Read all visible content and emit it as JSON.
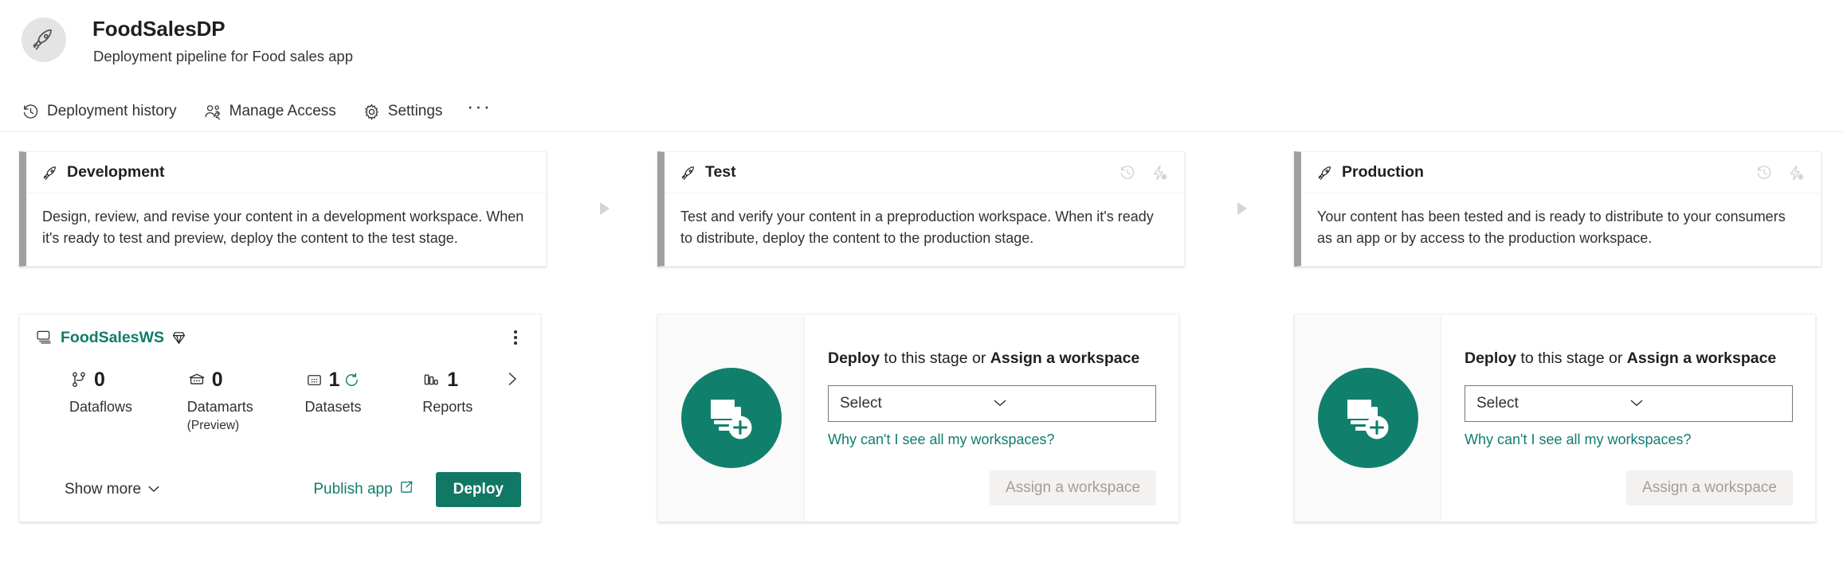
{
  "header": {
    "avatar_icon": "rocket-icon",
    "title": "FoodSalesDP",
    "subtitle": "Deployment pipeline for Food sales app"
  },
  "toolbar": {
    "items": [
      {
        "icon": "history-icon",
        "label": "Deployment history"
      },
      {
        "icon": "people-icon",
        "label": "Manage Access"
      },
      {
        "icon": "gear-icon",
        "label": "Settings"
      }
    ],
    "overflow_label": "···"
  },
  "colors": {
    "brand_green": "#117865",
    "link_teal": "#127c6d",
    "stage_accent": "#a19f9d",
    "disabled_text": "#a19f9d",
    "circle_green": "#10806c"
  },
  "stages": [
    {
      "name": "Development",
      "icon": "rocket-icon",
      "description": "Design, review, and revise your content in a development workspace. When it's ready to test and preview, deploy the content to the test stage.",
      "actions": []
    },
    {
      "name": "Test",
      "icon": "rocket-icon",
      "description": "Test and verify your content in a preproduction workspace. When it's ready to distribute, deploy the content to the production stage.",
      "actions": [
        {
          "icon": "history-icon"
        },
        {
          "icon": "deployment-rules-icon"
        }
      ]
    },
    {
      "name": "Production",
      "icon": "rocket-icon",
      "description": "Your content has been tested and is ready to distribute to your consumers as an app or by access to the production workspace.",
      "actions": [
        {
          "icon": "history-icon"
        },
        {
          "icon": "deployment-rules-icon"
        }
      ]
    }
  ],
  "connectors": [
    {
      "icon": "arrow-right-icon"
    },
    {
      "icon": "arrow-right-icon"
    }
  ],
  "workspace_card": {
    "stack_icon": "workspace-stack-icon",
    "name": "FoodSalesWS",
    "premium_icon": "premium-diamond-icon",
    "more_icon": "more-options-icon",
    "metrics": [
      {
        "icon": "dataflow-icon",
        "value": "0",
        "label": "Dataflows",
        "sublabel": ""
      },
      {
        "icon": "datamart-icon",
        "value": "0",
        "label": "Datamarts",
        "sublabel": "(Preview)"
      },
      {
        "icon": "dataset-icon",
        "value": "1",
        "label": "Datasets",
        "sublabel": "",
        "refresh_icon": "refresh-icon"
      },
      {
        "icon": "report-icon",
        "value": "1",
        "label": "Reports",
        "sublabel": ""
      }
    ],
    "next_icon": "chevron-right-icon",
    "show_more_label": "Show more",
    "show_more_icon": "chevron-down-icon",
    "publish_app_label": "Publish app",
    "publish_app_icon": "open-in-new-icon",
    "deploy_label": "Deploy"
  },
  "empty_stages": [
    {
      "circle_icon": "add-workspace-icon",
      "title_bold_1": "Deploy",
      "title_mid": " to this stage or ",
      "title_bold_2": "Assign a workspace",
      "select_value": "Select",
      "select_icon": "chevron-down-icon",
      "help_link": "Why can't I see all my workspaces?",
      "assign_label": "Assign a workspace"
    },
    {
      "circle_icon": "add-workspace-icon",
      "title_bold_1": "Deploy",
      "title_mid": " to this stage or ",
      "title_bold_2": "Assign a workspace",
      "select_value": "Select",
      "select_icon": "chevron-down-icon",
      "help_link": "Why can't I see all my workspaces?",
      "assign_label": "Assign a workspace"
    }
  ]
}
